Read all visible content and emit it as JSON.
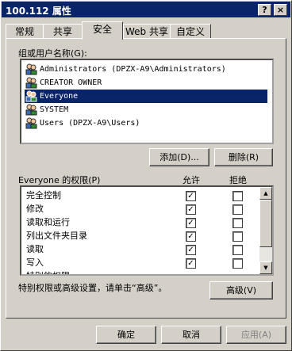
{
  "window": {
    "title": "100.112 属性",
    "help_glyph": "?",
    "close_glyph": "×"
  },
  "tabs": [
    {
      "label": "常规"
    },
    {
      "label": "共享"
    },
    {
      "label": "安全"
    },
    {
      "label": "Web 共享"
    },
    {
      "label": "自定义"
    }
  ],
  "active_tab": "安全",
  "security": {
    "group_label": "组或用户名称(G):",
    "users": [
      {
        "name": "Administrators (DPZX-A9\\Administrators)",
        "selected": false
      },
      {
        "name": "CREATOR OWNER",
        "selected": false
      },
      {
        "name": "Everyone",
        "selected": true
      },
      {
        "name": "SYSTEM",
        "selected": false
      },
      {
        "name": "Users (DPZX-A9\\Users)",
        "selected": false
      }
    ],
    "add_button": "添加(D)...",
    "remove_button": "删除(R)",
    "perm_label": "Everyone 的权限(P)",
    "allow_header": "允许",
    "deny_header": "拒绝",
    "permissions": [
      {
        "name": "完全控制",
        "allow": true,
        "deny": false
      },
      {
        "name": "修改",
        "allow": true,
        "deny": false
      },
      {
        "name": "读取和运行",
        "allow": true,
        "deny": false
      },
      {
        "name": "列出文件夹目录",
        "allow": true,
        "deny": false
      },
      {
        "name": "读取",
        "allow": true,
        "deny": false
      },
      {
        "name": "写入",
        "allow": true,
        "deny": false
      },
      {
        "name": "特别的权限",
        "allow": false,
        "deny": false
      }
    ],
    "advanced_hint": "特别权限或高级设置，请单击“高级”。",
    "advanced_button": "高级(V)"
  },
  "footer": {
    "ok": "确定",
    "cancel": "取消",
    "apply": "应用(A)"
  },
  "colors": {
    "titlebar": "#0a246a",
    "selection": "#0a246a",
    "face": "#d4d0c8"
  }
}
